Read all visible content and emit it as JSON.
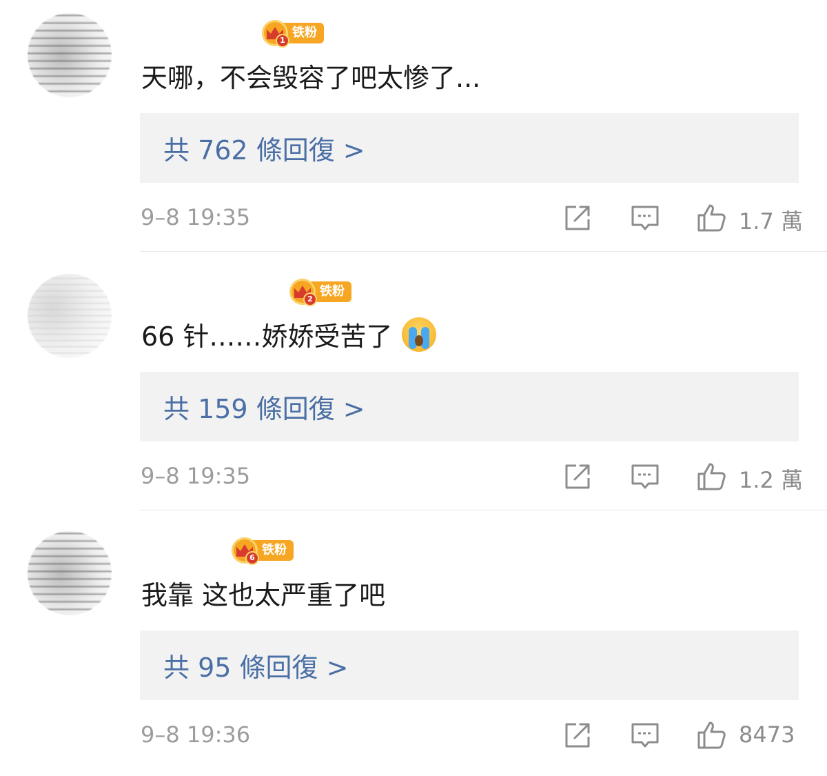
{
  "comments": [
    {
      "badge_level": "1",
      "badge_label": "铁粉",
      "text": "天哪，不会毁容了吧太惨了...",
      "emoji": "",
      "replies_label": "共 762 條回復 >",
      "time": "9–8 19:35",
      "likes": "1.7 萬"
    },
    {
      "badge_level": "2",
      "badge_label": "铁粉",
      "text": "66 针……娇娇受苦了",
      "emoji": "crying-face",
      "replies_label": "共 159 條回復 >",
      "time": "9–8 19:35",
      "likes": "1.2 萬"
    },
    {
      "badge_level": "6",
      "badge_label": "铁粉",
      "text": "我靠 这也太严重了吧",
      "emoji": "",
      "replies_label": "共 95 條回復 >",
      "time": "9–8 19:36",
      "likes": "8473"
    }
  ],
  "icons": {
    "share": "share-icon",
    "reply": "comment-icon",
    "like": "thumbs-up-icon"
  },
  "colors": {
    "badge_orange": "#f6a623",
    "badge_red": "#d63b2b",
    "link_blue": "#4a6fa5",
    "meta_gray": "#9c9c9c",
    "reply_box_bg": "#f2f2f2"
  }
}
